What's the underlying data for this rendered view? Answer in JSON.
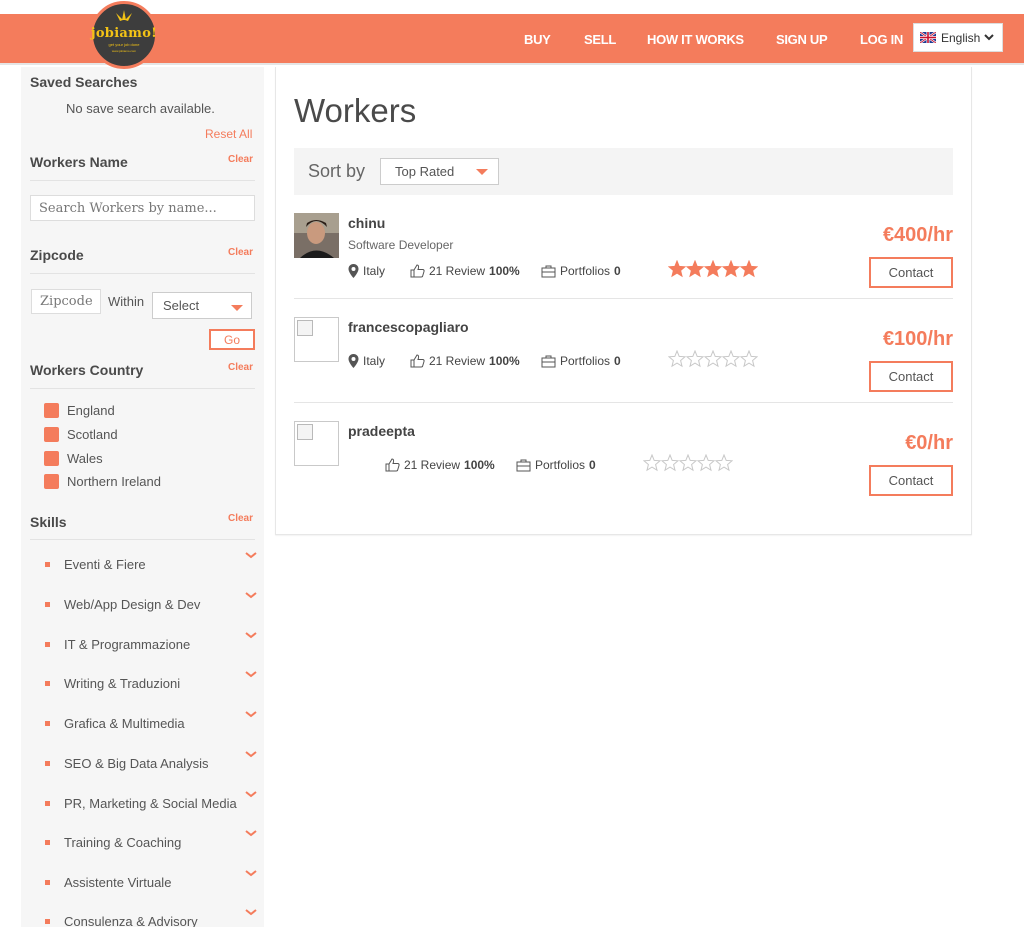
{
  "header": {
    "logo_text": "jobiamo!",
    "logo_tagline": "get your job done",
    "logo_url": "www.jobiamo.com",
    "nav": [
      {
        "label": "BUY"
      },
      {
        "label": "SELL"
      },
      {
        "label": "HOW IT WORKS"
      },
      {
        "label": "SIGN UP"
      },
      {
        "label": "LOG IN"
      }
    ],
    "language": "English",
    "accent_color": "#f47c5c"
  },
  "sidebar": {
    "saved_searches": {
      "title": "Saved Searches",
      "empty": "No save search available.",
      "reset": "Reset All"
    },
    "workers_name": {
      "title": "Workers Name",
      "clear": "Clear",
      "placeholder": "Search Workers by name..."
    },
    "zipcode": {
      "title": "Zipcode",
      "clear": "Clear",
      "placeholder": "Zipcode",
      "within": "Within",
      "select": "Select",
      "go": "Go"
    },
    "country": {
      "title": "Workers Country",
      "clear": "Clear",
      "items": [
        "England",
        "Scotland",
        "Wales",
        "Northern Ireland"
      ]
    },
    "skills": {
      "title": "Skills",
      "clear": "Clear",
      "items": [
        "Eventi & Fiere",
        "Web/App Design & Dev",
        "IT & Programmazione",
        "Writing & Traduzioni",
        "Grafica & Multimedia",
        "SEO & Big Data Analysis",
        "PR, Marketing & Social Media",
        "Training & Coaching",
        "Assistente Virtuale",
        "Consulenza & Advisory"
      ]
    }
  },
  "main": {
    "title": "Workers",
    "sort_label": "Sort by",
    "sort_value": "Top Rated",
    "workers": [
      {
        "name": "chinu",
        "role": "Software Developer",
        "location": "Italy",
        "reviews": "21 Review",
        "percent": "100%",
        "portfolios_label": "Portfolios",
        "portfolios": "0",
        "rating": 5,
        "price": "€400/hr",
        "contact": "Contact"
      },
      {
        "name": "francescopagliaro",
        "role": "",
        "location": "Italy",
        "reviews": "21 Review",
        "percent": "100%",
        "portfolios_label": "Portfolios",
        "portfolios": "0",
        "rating": 0,
        "price": "€100/hr",
        "contact": "Contact"
      },
      {
        "name": "pradeepta",
        "role": "",
        "location": "",
        "reviews": "21 Review",
        "percent": "100%",
        "portfolios_label": "Portfolios",
        "portfolios": "0",
        "rating": 0,
        "price": "€0/hr",
        "contact": "Contact"
      }
    ]
  }
}
